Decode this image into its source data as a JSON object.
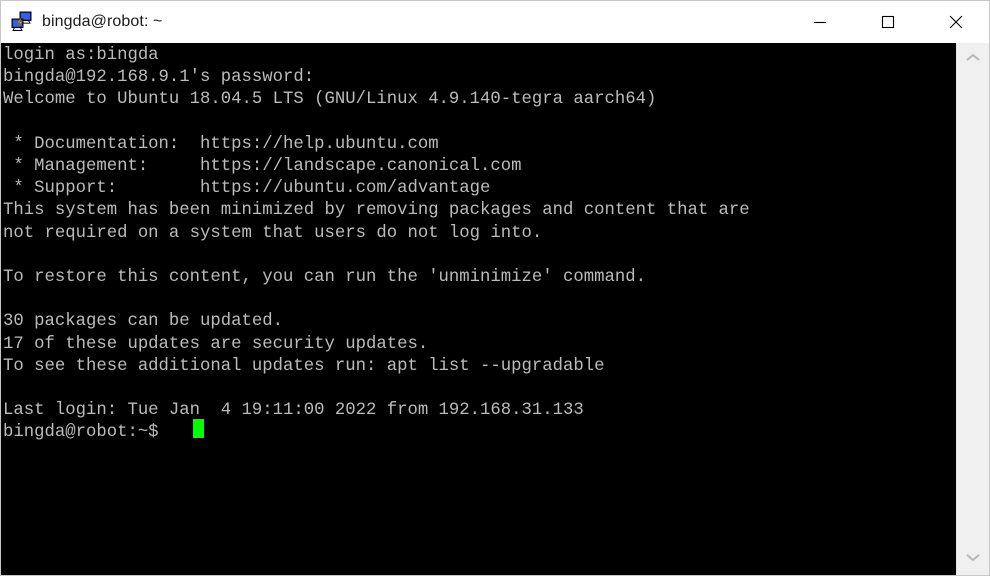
{
  "window": {
    "title": "bingda@robot: ~",
    "icon": "putty-icon",
    "background_color": "#ffffff"
  },
  "titlebar": {
    "minimize_label": "Minimize",
    "maximize_label": "Maximize",
    "close_label": "Close"
  },
  "terminal": {
    "background_color": "#000000",
    "text_color": "#bbbbbb",
    "cursor_color": "#00ff00",
    "font_size_px": 17,
    "columns": 95,
    "lines": [
      "login as:bingda",
      "bingda@192.168.9.1's password:",
      "Welcome to Ubuntu 18.04.5 LTS (GNU/Linux 4.9.140-tegra aarch64)",
      "",
      " * Documentation:  https://help.ubuntu.com",
      " * Management:     https://landscape.canonical.com",
      " * Support:        https://ubuntu.com/advantage",
      "This system has been minimized by removing packages and content that are",
      "not required on a system that users do not log into.",
      "",
      "To restore this content, you can run the 'unminimize' command.",
      "",
      "30 packages can be updated.",
      "17 of these updates are security updates.",
      "To see these additional updates run: apt list --upgradable",
      "",
      "Last login: Tue Jan  4 19:11:00 2022 from 192.168.31.133",
      "bingda@robot:~$ "
    ],
    "prompt": "bingda@robot:~$",
    "login_user": "bingda",
    "host_ip": "192.168.9.1",
    "os_release": "Ubuntu 18.04.5 LTS",
    "kernel": "GNU/Linux 4.9.140-tegra aarch64",
    "documentation_url": "https://help.ubuntu.com",
    "management_url": "https://landscape.canonical.com",
    "support_url": "https://ubuntu.com/advantage",
    "packages_updatable": "30",
    "security_updates": "17",
    "last_login": "Tue Jan  4 19:11:00 2022 from 192.168.31.133"
  },
  "scrollbar": {
    "up_arrow": "chevron-up-icon",
    "down_arrow": "chevron-down-icon",
    "track_color": "#f0f0f0"
  }
}
